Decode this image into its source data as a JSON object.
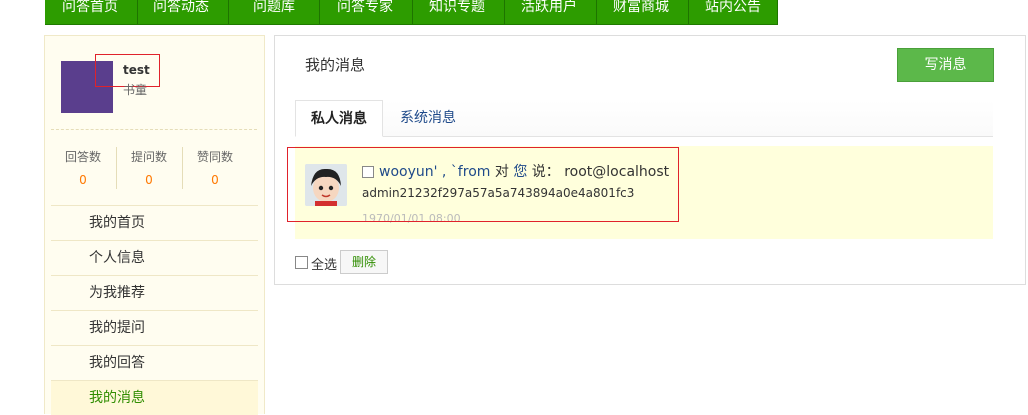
{
  "topnav": {
    "items": [
      "问答首页",
      "问答动态",
      "问题库",
      "问答专家",
      "知识专题",
      "活跃用户",
      "财富商城",
      "站内公告"
    ],
    "background": "#2d9c00"
  },
  "sidebar": {
    "user": {
      "name": "test",
      "role": "书童"
    },
    "stats": [
      {
        "label": "回答数",
        "value": "0"
      },
      {
        "label": "提问数",
        "value": "0"
      },
      {
        "label": "赞同数",
        "value": "0"
      }
    ],
    "menu": [
      "我的首页",
      "个人信息",
      "为我推荐",
      "我的提问",
      "我的回答",
      "我的消息"
    ],
    "active_menu": "我的消息"
  },
  "main": {
    "title": "我的消息",
    "write_button": "写消息",
    "tabs": [
      "私人消息",
      "系统消息"
    ],
    "active_tab": "私人消息",
    "message": {
      "sender": "wooyun' , `from",
      "to_text": "对",
      "you_text": "您",
      "says_text": "说：",
      "content_head": "root@localhost",
      "content_body": "admin21232f297a57a5a743894a0e4a801fc3",
      "time": "1970/01/01 08:00"
    },
    "select_all": "全选",
    "delete_button": "删除"
  },
  "colors": {
    "accent": "#2d9c00",
    "button_green": "#5cb84a",
    "count_orange": "#ff7800",
    "highlight": "#ffffdc",
    "annotation_red": "#e0222b"
  }
}
